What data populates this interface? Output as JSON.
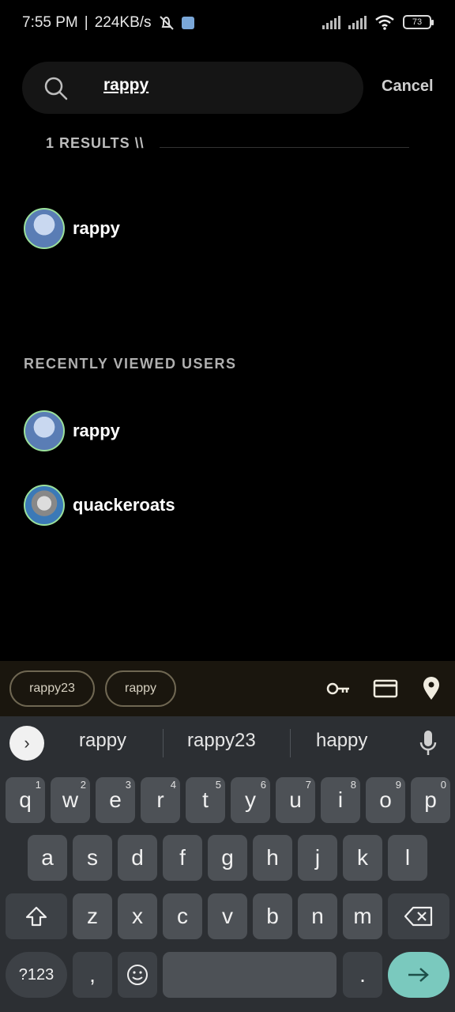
{
  "status_bar": {
    "time": "7:55 PM",
    "separator": "|",
    "speed": "224KB/s",
    "battery": "73"
  },
  "search": {
    "query": "rappy",
    "cancel_label": "Cancel"
  },
  "results": {
    "label": "1 RESULTS \\\\",
    "items": [
      {
        "username": "rappy"
      }
    ]
  },
  "recent": {
    "label": "RECENTLY VIEWED USERS",
    "items": [
      {
        "username": "rappy"
      },
      {
        "username": "quackeroats"
      }
    ]
  },
  "autofill": {
    "chips": [
      "rappy23",
      "rappy"
    ],
    "icons": [
      "key-icon",
      "card-icon",
      "location-pin-icon"
    ]
  },
  "keyboard": {
    "suggestions": [
      "rappy",
      "rappy23",
      "happy"
    ],
    "row1": [
      {
        "k": "q",
        "n": "1"
      },
      {
        "k": "w",
        "n": "2"
      },
      {
        "k": "e",
        "n": "3"
      },
      {
        "k": "r",
        "n": "4"
      },
      {
        "k": "t",
        "n": "5"
      },
      {
        "k": "y",
        "n": "6"
      },
      {
        "k": "u",
        "n": "7"
      },
      {
        "k": "i",
        "n": "8"
      },
      {
        "k": "o",
        "n": "9"
      },
      {
        "k": "p",
        "n": "0"
      }
    ],
    "row2": [
      "a",
      "s",
      "d",
      "f",
      "g",
      "h",
      "j",
      "k",
      "l"
    ],
    "row3": [
      "z",
      "x",
      "c",
      "v",
      "b",
      "n",
      "m"
    ],
    "symbols_label": "?123",
    "comma_label": ",",
    "period_label": "."
  }
}
